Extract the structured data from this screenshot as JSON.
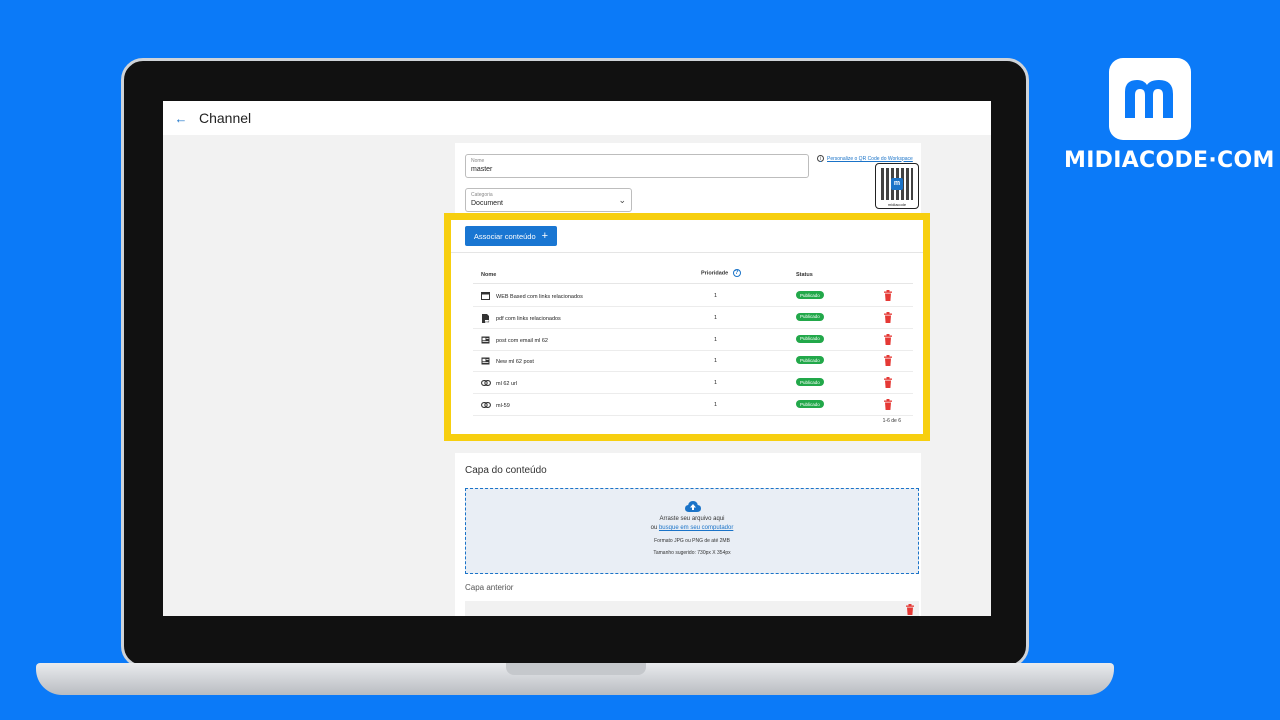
{
  "app": {
    "title": "Channel"
  },
  "form": {
    "name_label": "Nome",
    "name_value": "master",
    "category_label": "Categoria",
    "category_value": "Document"
  },
  "qr": {
    "link_text": "Personalize o QR Code do Workspace",
    "caption": "midiacode"
  },
  "content": {
    "associate_button": "Associar conteúdo",
    "columns": {
      "name": "Nome",
      "priority": "Prioridade",
      "status": "Status"
    },
    "rows": [
      {
        "name": "WEB Based com links relacionados",
        "priority": "1",
        "status": "Publicado",
        "icon": "web-icon"
      },
      {
        "name": "pdf com links relacionados",
        "priority": "1",
        "status": "Publicado",
        "icon": "pdf-icon"
      },
      {
        "name": "post com email ml 62",
        "priority": "1",
        "status": "Publicado",
        "icon": "post-icon"
      },
      {
        "name": "New ml 62 post",
        "priority": "1",
        "status": "Publicado",
        "icon": "post-icon"
      },
      {
        "name": "ml 62 url",
        "priority": "1",
        "status": "Publicado",
        "icon": "link-icon"
      },
      {
        "name": "ml-59",
        "priority": "1",
        "status": "Publicado",
        "icon": "link-icon"
      }
    ],
    "pagination": "1-6 de 6"
  },
  "cover": {
    "title": "Capa do conteúdo",
    "drop_text": "Arraste seu arquivo aqui",
    "or_text": "ou ",
    "browse_link": "busque em seu computador",
    "format_text": "Formato JPG ou PNG de até 2MB",
    "size_text": "Tamanho sugerido: 730px X 354px",
    "previous_title": "Capa anterior"
  },
  "brand": {
    "name": "MIDIACODE·COM",
    "letter": "m"
  },
  "colors": {
    "background": "#0b7af8",
    "highlight": "#f7cf0f",
    "primary": "#1976d2",
    "status": "#22a84a",
    "delete": "#e53935"
  }
}
